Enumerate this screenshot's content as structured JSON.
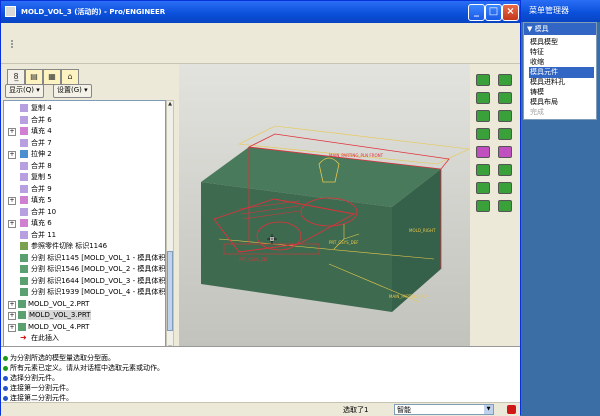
{
  "window": {
    "title": "MOLD_VOL_3 (活动的) - Pro/ENGINEER"
  },
  "panel": {
    "show_label": "显示(Q) ▾",
    "settings_label": "设置(G) ▾"
  },
  "tree": [
    {
      "label": "复制 4",
      "icon": "copy-icon",
      "expand": ""
    },
    {
      "label": "合并 6",
      "icon": "merge-icon",
      "expand": ""
    },
    {
      "label": "填充 4",
      "icon": "fill-icon",
      "expand": "+"
    },
    {
      "label": "合并 7",
      "icon": "merge-icon",
      "expand": ""
    },
    {
      "label": "拉伸 2",
      "icon": "extrude-icon",
      "expand": "+"
    },
    {
      "label": "合并 8",
      "icon": "merge-icon",
      "expand": ""
    },
    {
      "label": "复制 5",
      "icon": "copy-icon",
      "expand": ""
    },
    {
      "label": "合并 9",
      "icon": "merge-icon",
      "expand": ""
    },
    {
      "label": "填充 5",
      "icon": "fill-icon",
      "expand": "+"
    },
    {
      "label": "合并 10",
      "icon": "merge-icon",
      "expand": ""
    },
    {
      "label": "填充 6",
      "icon": "fill-icon",
      "expand": "+"
    },
    {
      "label": "合并 11",
      "icon": "merge-icon",
      "expand": ""
    },
    {
      "label": "参照零件切除 标识1146",
      "icon": "cut-icon",
      "expand": ""
    },
    {
      "label": "分割 标识1145 [MOLD_VOL_1 - 模具体积 块]",
      "icon": "split-icon",
      "expand": ""
    },
    {
      "label": "分割 标识1546 [MOLD_VOL_2 - 模具体积 块]",
      "icon": "split-icon",
      "expand": ""
    },
    {
      "label": "分割 标识1644 [MOLD_VOL_3 - 模具体积 块]",
      "icon": "split-icon",
      "expand": ""
    },
    {
      "label": "分割 标识1939 [MOLD_VOL_4 - 模具体积 块]",
      "icon": "split-icon",
      "expand": ""
    },
    {
      "label": "MOLD_VOL_2.PRT",
      "icon": "part-icon",
      "expand": "+"
    },
    {
      "label": "MOLD_VOL_3.PRT",
      "icon": "part-icon",
      "expand": "+",
      "selected": true
    },
    {
      "label": "MOLD_VOL_4.PRT",
      "icon": "part-icon",
      "expand": "+"
    },
    {
      "label": "在此插入",
      "icon": "insert-arrow-icon",
      "expand": ""
    }
  ],
  "viewport": {
    "labels": {
      "top_front": "MAIN_PARTING_PLN FRONT",
      "right": "MOLD_RIGHT",
      "bottom": "MAIN_PARTING_PLN",
      "left": "PRT_CSYS_DEF",
      "csys": "PRT_CSYS_DEF"
    }
  },
  "messages": [
    {
      "text": "为分割所选的模型量选取分型面。",
      "color": "#1a9b1a"
    },
    {
      "text": "所有元素已定义。请从对话框中选取元素或动作。",
      "color": "#1a9b1a"
    },
    {
      "text": "选择分割元件。",
      "color": "#2255cc"
    },
    {
      "text": "连接第一分割元件。",
      "color": "#2255cc"
    },
    {
      "text": "连接第二分割元件。",
      "color": "#2255cc"
    }
  ],
  "status": {
    "selected": "选取了1",
    "filter": "智能"
  },
  "menu_manager": {
    "title": "菜单管理器",
    "section": "模具",
    "items": [
      {
        "label": "模具模型",
        "state": "normal"
      },
      {
        "label": "特征",
        "state": "normal"
      },
      {
        "label": "收缩",
        "state": "normal"
      },
      {
        "label": "模具元件",
        "state": "selected"
      },
      {
        "label": "模具进料孔",
        "state": "normal"
      },
      {
        "label": "铸模",
        "state": "normal"
      },
      {
        "label": "模具布局",
        "state": "normal"
      },
      {
        "label": "完成",
        "state": "disabled"
      }
    ]
  },
  "colors": {
    "part_green": "#3e6b50",
    "outline_red": "#e0303a",
    "datum_yellow": "#e8c84a",
    "titlebar": "#0a4fd9",
    "select_blue": "#3166c4"
  }
}
